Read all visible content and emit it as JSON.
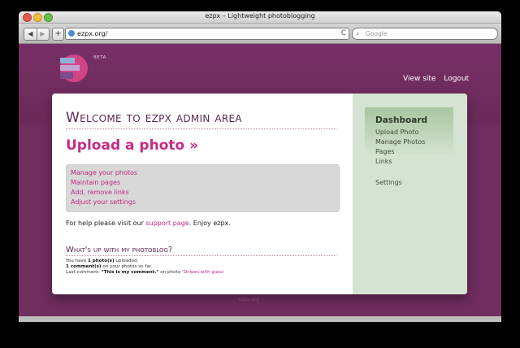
{
  "window": {
    "title": "ezpx – Lightweight photoblogging"
  },
  "toolbar": {
    "back": "◀",
    "forward": "▶",
    "add": "+",
    "url": "ezpx.org/",
    "reload": "C",
    "search_placeholder": "Google"
  },
  "site": {
    "beta": "BETA",
    "nav": [
      "View site",
      "Logout"
    ]
  },
  "main": {
    "welcome": "Welcome to ezpx admin area",
    "upload": "Upload a photo »",
    "quick_links": [
      "Manage your photos",
      "Maintain pages",
      "Add, remove links",
      "Adjust your settings"
    ],
    "help_prefix": "For help please visit our",
    "help_link": "support page",
    "help_suffix": ". Enjoy ezpx.",
    "whats_up": "What's up with my photoblog?",
    "stats": {
      "line1_a": "You have",
      "line1_b": "1 photo(s)",
      "line1_c": "uploaded.",
      "line2_a": "1 comment(s)",
      "line2_b": "on your photos so far.",
      "line3_a": "Last comment:",
      "line3_b": "\"This is my comment.\"",
      "line3_c": "on photo",
      "line3_d": "'Stripes with glass'"
    }
  },
  "sidebar": {
    "title": "Dashboard",
    "items": [
      "Upload Photo",
      "Manage Photos",
      "Pages",
      "Links",
      "Settings"
    ]
  },
  "footer": {
    "text": "ezpx.org"
  },
  "colors": {
    "brand": "#c52c86",
    "background": "#6f2c5e",
    "sidebar": "#d5e3d2"
  }
}
